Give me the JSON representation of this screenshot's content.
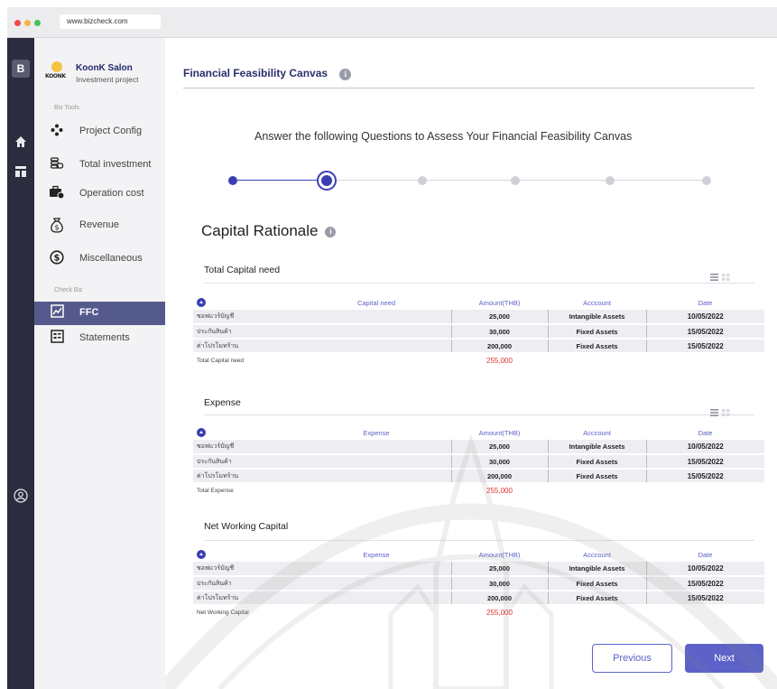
{
  "browser": {
    "url": "www.bizcheck.com",
    "dot_colors": [
      "#ee4c4a",
      "#f4b63f",
      "#46c35a"
    ]
  },
  "rail": {
    "logo_letter": "B",
    "icons": [
      "home-icon",
      "dashboard-icon",
      "user-account-icon"
    ]
  },
  "sidebar": {
    "brand": {
      "logo_text": "KOONK",
      "name": "KoonK Salon",
      "subtitle": "Investment project"
    },
    "biz_tools_label": "Biz Tools",
    "check_biz_label": "Check Biz",
    "tools": [
      {
        "label": "Project Config",
        "icon": "project-config-icon"
      },
      {
        "label": "Total investment",
        "icon": "coins-icon"
      },
      {
        "label": "Operation cost",
        "icon": "briefcase-icon"
      },
      {
        "label": "Revenue",
        "icon": "money-bag-icon"
      },
      {
        "label": "Miscellaneous",
        "icon": "dollar-circle-icon"
      }
    ],
    "check": [
      {
        "label": "FFC",
        "icon": "chart-icon",
        "active": true
      },
      {
        "label": "Statements",
        "icon": "statement-icon",
        "active": false
      }
    ]
  },
  "main": {
    "title": "Financial Feasibility Canvas",
    "info_glyph": "i",
    "subtitle": "Answer the following Questions to Assess Your Financial Feasibility Canvas",
    "stepper": {
      "total_steps": 6,
      "current_step": 2
    },
    "section_heading": "Capital Rationale",
    "accent_color": "#5c62c8",
    "total_color": "#e0322d",
    "tables": [
      {
        "title": "Total Capital need",
        "show_view_icons": true,
        "headers": [
          "Capital need",
          "Amount(THB)",
          "Acccount",
          "Date"
        ],
        "rows": [
          [
            "ซอฟแวร์บัญชี",
            "25,000",
            "Intangible Assets",
            "10/05/2022"
          ],
          [
            "ประกันสินค้า",
            "30,000",
            "Fixed Assets",
            "15/05/2022"
          ],
          [
            "ค่าโปรโมทร้าน",
            "200,000",
            "Fixed Assets",
            "15/05/2022"
          ]
        ],
        "total_label": "Total Capital need",
        "total_value": "255,000"
      },
      {
        "title": "Expense",
        "show_view_icons": true,
        "headers": [
          "Expense",
          "Amount(THB)",
          "Acccount",
          "Date"
        ],
        "rows": [
          [
            "ซอฟแวร์บัญชี",
            "25,000",
            "Intangible Assets",
            "10/05/2022"
          ],
          [
            "ประกันสินค้า",
            "30,000",
            "Fixed Assets",
            "15/05/2022"
          ],
          [
            "ค่าโปรโมทร้าน",
            "200,000",
            "Fixed Assets",
            "15/05/2022"
          ]
        ],
        "total_label": "Total Expense",
        "total_value": "255,000"
      },
      {
        "title": "Net Working Capital",
        "show_view_icons": false,
        "headers": [
          "Expense",
          "Amount(THB)",
          "Acccount",
          "Date"
        ],
        "rows": [
          [
            "ซอฟแวร์บัญชี",
            "25,000",
            "Intangible Assets",
            "10/05/2022"
          ],
          [
            "ประกันสินค้า",
            "30,000",
            "Fixed Assets",
            "15/05/2022"
          ],
          [
            "ค่าโปรโมทร้าน",
            "200,000",
            "Fixed Assets",
            "15/05/2022"
          ]
        ],
        "total_label": "Net Working Capital",
        "total_value": "255,000"
      }
    ],
    "buttons": {
      "previous": "Previous",
      "next": "Next"
    }
  }
}
